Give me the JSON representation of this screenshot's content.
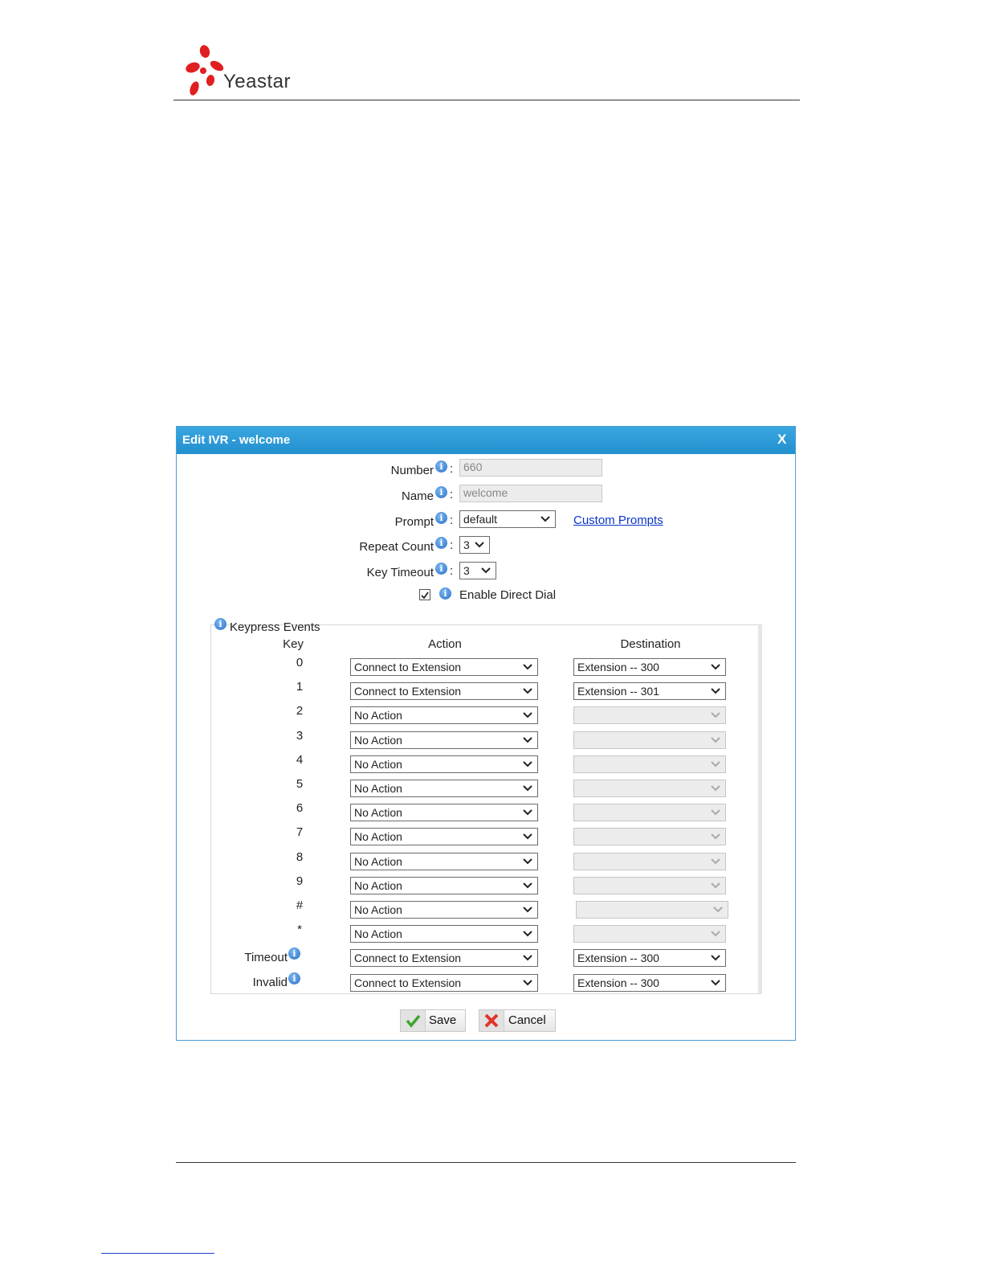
{
  "header": {
    "brand": "Yeastar"
  },
  "dialog": {
    "title": "Edit IVR - welcome",
    "close_label": "X",
    "fields": {
      "number": {
        "label": "Number",
        "value": "660"
      },
      "name": {
        "label": "Name",
        "value": "welcome"
      },
      "prompt": {
        "label": "Prompt",
        "value": "default",
        "link": "Custom Prompts"
      },
      "repeat_count": {
        "label": "Repeat Count",
        "value": "3"
      },
      "key_timeout": {
        "label": "Key Timeout",
        "value": "3"
      },
      "direct_dial": {
        "label": "Enable Direct Dial",
        "checked": true
      }
    },
    "colon": ":",
    "keypress": {
      "legend": "Keypress Events",
      "headers": {
        "key": "Key",
        "action": "Action",
        "destination": "Destination"
      },
      "rows": [
        {
          "key": "0",
          "action": "Connect to Extension",
          "destination": "Extension -- 300"
        },
        {
          "key": "1",
          "action": "Connect to Extension",
          "destination": "Extension -- 301"
        },
        {
          "key": "2",
          "action": "No Action",
          "destination": ""
        },
        {
          "key": "3",
          "action": "No Action",
          "destination": ""
        },
        {
          "key": "4",
          "action": "No Action",
          "destination": ""
        },
        {
          "key": "5",
          "action": "No Action",
          "destination": ""
        },
        {
          "key": "6",
          "action": "No Action",
          "destination": ""
        },
        {
          "key": "7",
          "action": "No Action",
          "destination": ""
        },
        {
          "key": "8",
          "action": "No Action",
          "destination": ""
        },
        {
          "key": "9",
          "action": "No Action",
          "destination": ""
        },
        {
          "key": "#",
          "action": "No Action",
          "destination": ""
        },
        {
          "key": "*",
          "action": "No Action",
          "destination": ""
        },
        {
          "key": "Timeout",
          "action": "Connect to Extension",
          "destination": "Extension -- 300"
        },
        {
          "key": "Invalid",
          "action": "Connect to Extension",
          "destination": "Extension -- 300"
        }
      ]
    },
    "buttons": {
      "save": "Save",
      "cancel": "Cancel"
    }
  },
  "colors": {
    "titlebar": "#2390cf",
    "link": "#0b35c9",
    "save_icon": "#3aa62a",
    "cancel_icon": "#e0352b"
  },
  "icons": {
    "info": "info-icon",
    "chevron": "chevron-down-icon",
    "check": "check-icon",
    "cancel": "x-icon"
  }
}
